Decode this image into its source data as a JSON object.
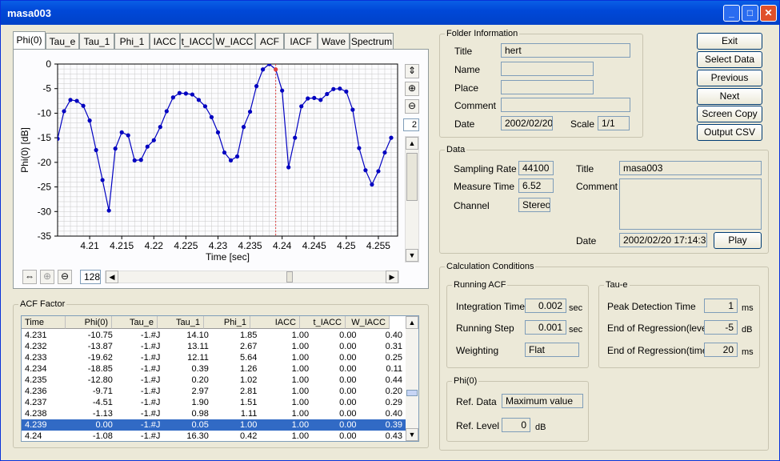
{
  "window": {
    "title": "masa003"
  },
  "tabs": [
    "Phi(0)",
    "Tau_e",
    "Tau_1",
    "Phi_1",
    "IACC",
    "t_IACC",
    "W_IACC",
    "ACF",
    "IACF",
    "Wave",
    "Spectrum"
  ],
  "chart_data": {
    "type": "line",
    "xlabel": "Time [sec]",
    "ylabel": "Phi(0) [dB]",
    "xlim": [
      4.205,
      4.258
    ],
    "ylim": [
      -35,
      0
    ],
    "xticks": [
      4.21,
      4.215,
      4.22,
      4.225,
      4.23,
      4.235,
      4.24,
      4.245,
      4.25,
      4.255
    ],
    "yticks": [
      0,
      -5,
      -10,
      -15,
      -20,
      -25,
      -30,
      -35
    ],
    "grid": true,
    "cursor_x": 4.239,
    "x": [
      4.205,
      4.206,
      4.207,
      4.208,
      4.209,
      4.21,
      4.211,
      4.212,
      4.213,
      4.214,
      4.215,
      4.216,
      4.217,
      4.218,
      4.219,
      4.22,
      4.221,
      4.222,
      4.223,
      4.224,
      4.225,
      4.226,
      4.227,
      4.228,
      4.229,
      4.23,
      4.231,
      4.232,
      4.233,
      4.234,
      4.235,
      4.236,
      4.237,
      4.238,
      4.239,
      4.24,
      4.241,
      4.242,
      4.243,
      4.244,
      4.245,
      4.246,
      4.247,
      4.248,
      4.249,
      4.25,
      4.251,
      4.252,
      4.253,
      4.254,
      4.255,
      4.256,
      4.257
    ],
    "y": [
      -15.2,
      -9.6,
      -7.3,
      -7.5,
      -8.5,
      -11.5,
      -17.5,
      -23.6,
      -29.8,
      -17.2,
      -13.9,
      -14.5,
      -19.6,
      -19.5,
      -16.8,
      -15.5,
      -12.8,
      -9.6,
      -6.8,
      -5.9,
      -6.0,
      -6.2,
      -7.3,
      -8.6,
      -10.8,
      -13.9,
      -18.0,
      -19.6,
      -18.8,
      -12.8,
      -9.7,
      -4.5,
      -1.1,
      0.0,
      -1.1,
      -5.4,
      -21.0,
      -15.0,
      -8.6,
      -7.0,
      -6.9,
      -7.3,
      -6.1,
      -5.1,
      -5.0,
      -5.6,
      -9.3,
      -17.1,
      -21.6,
      -24.5,
      -21.8,
      -18.0,
      -15.0
    ]
  },
  "chart_controls": {
    "zoom_value": "2",
    "scale_value": "128"
  },
  "folder": {
    "legend": "Folder Information",
    "title_label": "Title",
    "title_value": "hert",
    "name_label": "Name",
    "name_value": "",
    "place_label": "Place",
    "place_value": "",
    "comment_label": "Comment",
    "comment_value": "",
    "date_label": "Date",
    "date_value": "2002/02/20",
    "scale_label": "Scale",
    "scale_value": "1/1"
  },
  "buttons": {
    "exit": "Exit",
    "select_data": "Select Data",
    "previous": "Previous",
    "next": "Next",
    "screen_copy": "Screen Copy",
    "output_csv": "Output CSV",
    "play": "Play"
  },
  "data": {
    "legend": "Data",
    "sampling_rate_label": "Sampling Rate",
    "sampling_rate_value": "44100",
    "measure_time_label": "Measure Time",
    "measure_time_value": "6.52",
    "channel_label": "Channel",
    "channel_value": "Stereo",
    "title_label": "Title",
    "title_value": "masa003",
    "comment_label": "Comment",
    "comment_value": "",
    "date_label": "Date",
    "date_value": "2002/02/20 17:14:37"
  },
  "calc": {
    "legend": "Calculation Conditions",
    "running_acf": {
      "legend": "Running ACF",
      "integration_time_label": "Integration Time",
      "integration_time_value": "0.002",
      "integration_time_unit": "sec",
      "running_step_label": "Running Step",
      "running_step_value": "0.001",
      "running_step_unit": "sec",
      "weighting_label": "Weighting",
      "weighting_value": "Flat"
    },
    "tau_e": {
      "legend": "Tau-e",
      "peak_label": "Peak Detection Time",
      "peak_value": "1",
      "peak_unit": "ms",
      "eor_level_label": "End of Regression(level)",
      "eor_level_value": "-5",
      "eor_level_unit": "dB",
      "eor_time_label": "End of Regression(time)",
      "eor_time_value": "20",
      "eor_time_unit": "ms"
    },
    "phi0": {
      "legend": "Phi(0)",
      "ref_data_label": "Ref. Data",
      "ref_data_value": "Maximum value",
      "ref_level_label": "Ref. Level",
      "ref_level_value": "0",
      "ref_level_unit": "dB"
    }
  },
  "acf_factor": {
    "legend": "ACF Factor",
    "columns": [
      "Time",
      "Phi(0)",
      "Tau_e",
      "Tau_1",
      "Phi_1",
      "IACC",
      "t_IACC",
      "W_IACC"
    ],
    "rows": [
      [
        "4.231",
        "-10.75",
        "-1.#J",
        "14.10",
        "1.85",
        "1.00",
        "0.00",
        "0.40"
      ],
      [
        "4.232",
        "-13.87",
        "-1.#J",
        "13.11",
        "2.67",
        "1.00",
        "0.00",
        "0.31"
      ],
      [
        "4.233",
        "-19.62",
        "-1.#J",
        "12.11",
        "5.64",
        "1.00",
        "0.00",
        "0.25"
      ],
      [
        "4.234",
        "-18.85",
        "-1.#J",
        "0.39",
        "1.26",
        "1.00",
        "0.00",
        "0.11"
      ],
      [
        "4.235",
        "-12.80",
        "-1.#J",
        "0.20",
        "1.02",
        "1.00",
        "0.00",
        "0.44"
      ],
      [
        "4.236",
        "-9.71",
        "-1.#J",
        "2.97",
        "2.81",
        "1.00",
        "0.00",
        "0.20"
      ],
      [
        "4.237",
        "-4.51",
        "-1.#J",
        "1.90",
        "1.51",
        "1.00",
        "0.00",
        "0.29"
      ],
      [
        "4.238",
        "-1.13",
        "-1.#J",
        "0.98",
        "1.11",
        "1.00",
        "0.00",
        "0.40"
      ],
      [
        "4.239",
        "0.00",
        "-1.#J",
        "0.05",
        "1.00",
        "1.00",
        "0.00",
        "0.39"
      ],
      [
        "4.24",
        "-1.08",
        "-1.#J",
        "16.30",
        "0.42",
        "1.00",
        "0.00",
        "0.43"
      ]
    ],
    "selected_index": 8
  }
}
